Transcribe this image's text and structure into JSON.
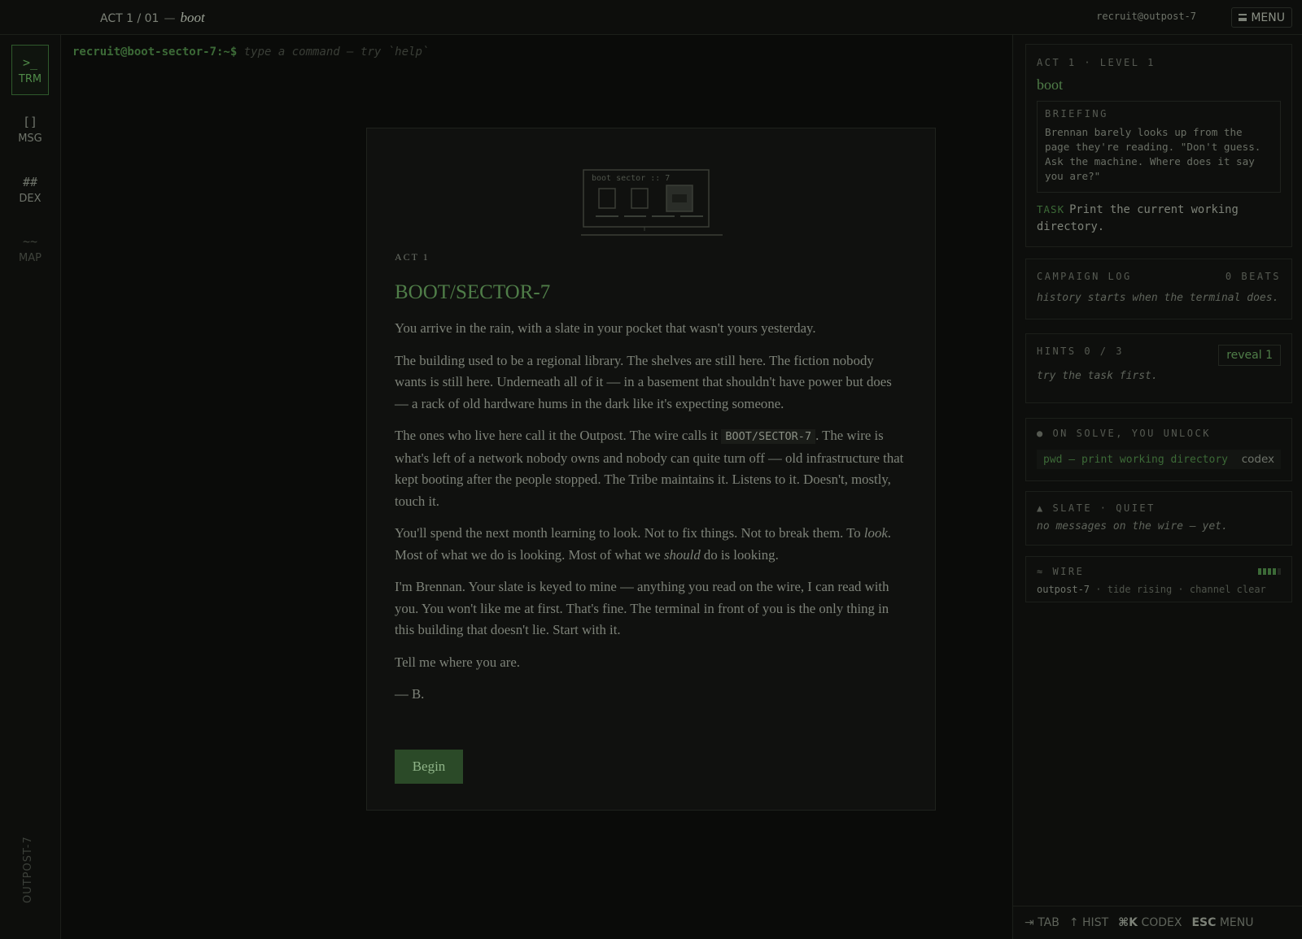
{
  "header": {
    "act_prefix": "ACT 1 / 01",
    "separator": "—",
    "level_name": "boot",
    "user": "recruit@outpost-7",
    "menu_label": "MENU"
  },
  "rail": {
    "items": [
      {
        "glyph": ">_",
        "label": "TRM"
      },
      {
        "glyph": "[]",
        "label": "MSG"
      },
      {
        "glyph": "##",
        "label": "DEX"
      },
      {
        "glyph": "~~",
        "label": "MAP"
      }
    ],
    "footer": "OUTPOST-7"
  },
  "terminal": {
    "prompt": "recruit@boot-sector-7:~$",
    "placeholder": "type a command — try `help`"
  },
  "modal": {
    "art_caption": "boot sector :: 7",
    "act": "ACT 1",
    "title": "BOOT/SECTOR-7",
    "p1": "You arrive in the rain, with a slate in your pocket that wasn't yours yesterday.",
    "p2": "The building used to be a regional library. The shelves are still here. The fiction nobody wants is still here. Underneath all of it — in a basement that shouldn't have power but does — a rack of old hardware hums in the dark like it's expecting someone.",
    "p3_a": "The ones who live here call it the Outpost. The wire calls it",
    "p3_code": "BOOT/SECTOR-7",
    "p3_b": ". The wire is what's left of a network nobody owns and nobody can quite turn off — old infrastructure that kept booting after the people stopped. The Tribe maintains it. Listens to it. Doesn't, mostly, touch it.",
    "p4_a": "You'll spend the next month learning to look. Not to fix things. Not to break them. To",
    "p4_em1": "look",
    "p4_b": ". Most of what we do is looking. Most of what we",
    "p4_em2": "should",
    "p4_c": "do is looking.",
    "p5": "I'm Brennan. Your slate is keyed to mine — anything you read on the wire, I can read with you. You won't like me at first. That's fine. The terminal in front of you is the only thing in this building that doesn't lie. Start with it.",
    "p6": "Tell me where you are.",
    "p7": "— B.",
    "begin_label": "Begin"
  },
  "side": {
    "level": {
      "kicker": "ACT 1 · LEVEL 1",
      "name": "boot",
      "briefing_label": "BRIEFING",
      "briefing": "Brennan barely looks up from the page they're reading. \"Don't guess. Ask the machine. Where does it say you are?\"",
      "task_label": "TASK",
      "task": "Print the current working directory."
    },
    "log": {
      "kicker": "CAMPAIGN LOG",
      "count": "0 BEATS",
      "note": "history starts when the terminal does."
    },
    "hints": {
      "kicker": "HINTS 0 / 3",
      "reveal_label": "reveal 1",
      "note": "try the task first."
    },
    "unlock": {
      "kicker": "● ON SOLVE, YOU UNLOCK",
      "item": "pwd — print working directory",
      "tag": "codex"
    },
    "slate": {
      "kicker": "▲ SLATE · QUIET",
      "note": "no messages on the wire — yet."
    },
    "wire": {
      "kicker": "≈ WIRE",
      "signal_bars_on": 4,
      "signal_bars_total": 5,
      "host": "outpost-7",
      "status": "· tide rising · channel clear"
    }
  },
  "shortcuts": [
    {
      "key": "⇥",
      "label": "TAB"
    },
    {
      "key": "↑",
      "label": "HIST"
    },
    {
      "key": "⌘K",
      "label": "CODEX"
    },
    {
      "key": "ESC",
      "label": "MENU"
    }
  ],
  "colors": {
    "accent_green": "#4f7d48",
    "background": "#0b0c0a",
    "button_bg": "#2b4a28"
  }
}
